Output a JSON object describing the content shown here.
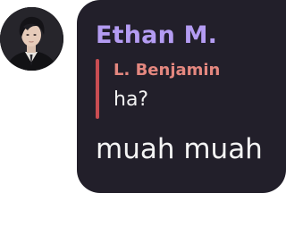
{
  "message": {
    "sender_name": "Ethan M.",
    "avatar_icon": "user-avatar-photo",
    "reply": {
      "author": "L. Benjamin",
      "text": "ha?"
    },
    "text": "muah muah"
  },
  "colors": {
    "bubble_bg": "#221f2a",
    "sender_name": "#b49cf2",
    "reply_bar": "#c94d52",
    "reply_author": "#e4877f",
    "text": "#f4f4f4"
  }
}
